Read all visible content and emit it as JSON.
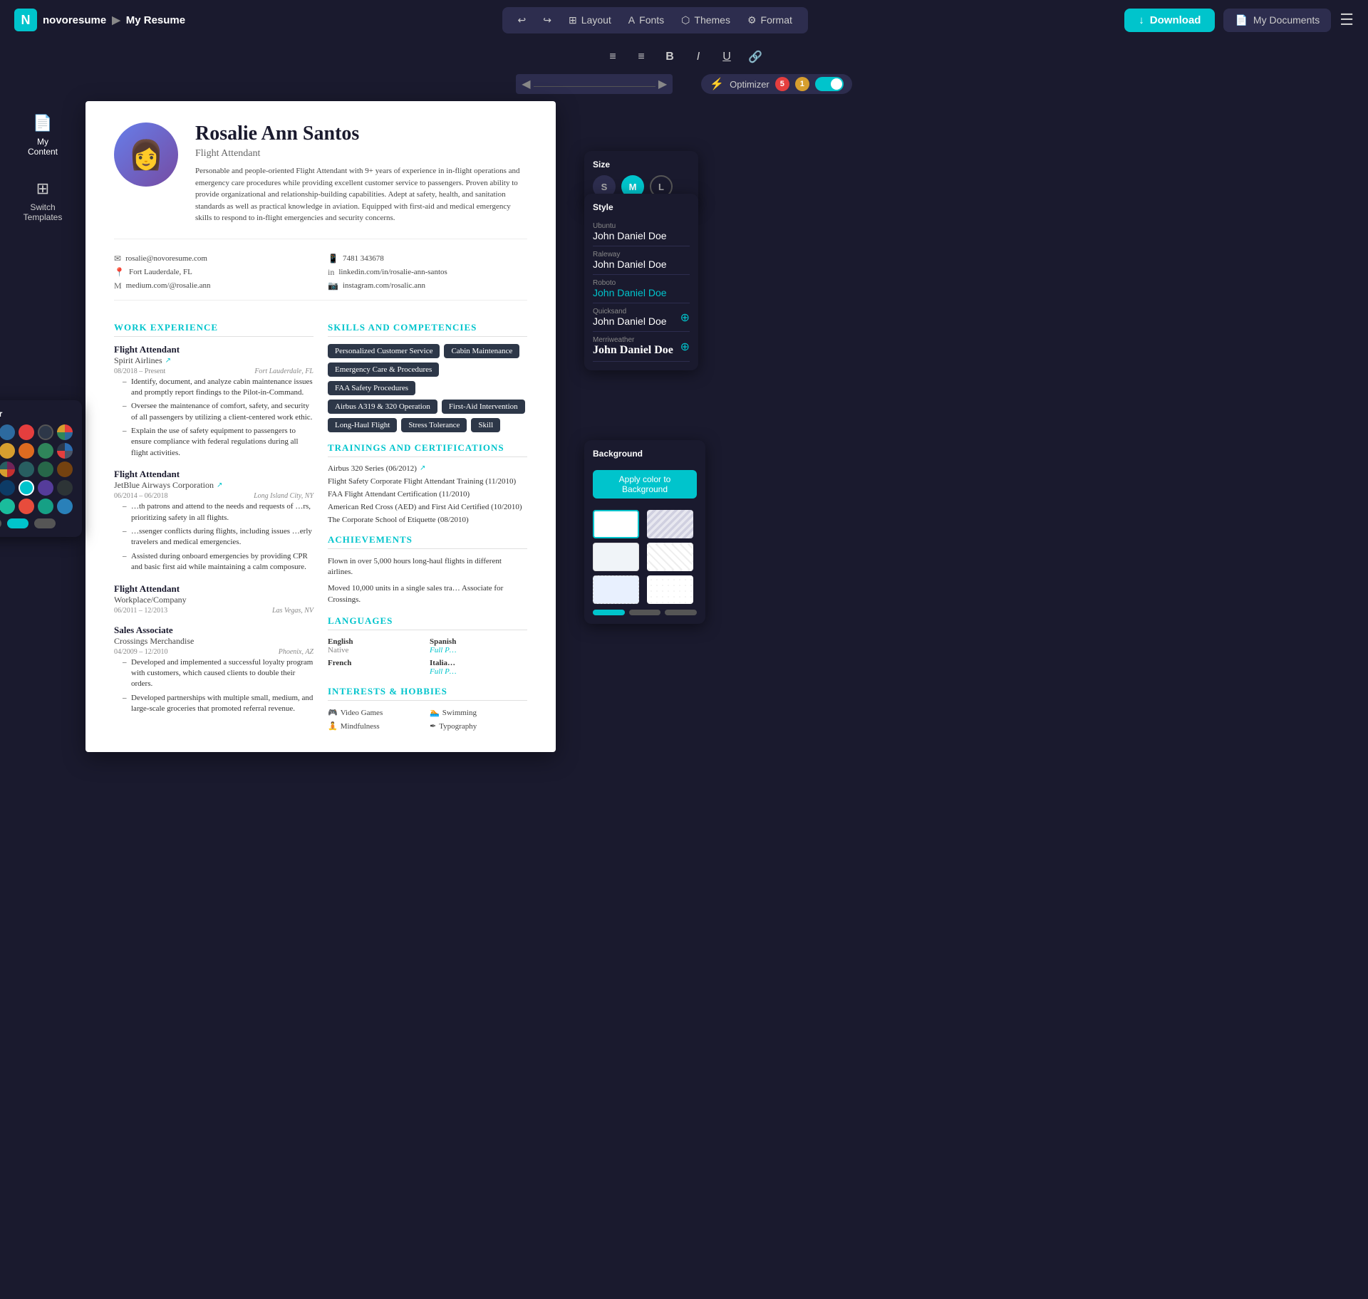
{
  "app": {
    "logo_text": "N",
    "brand_name": "novoresume",
    "breadcrumb_sep": "▶",
    "page_name": "My Resume"
  },
  "navbar": {
    "undo_icon": "↩",
    "redo_icon": "↪",
    "layout_label": "Layout",
    "fonts_label": "Fonts",
    "themes_label": "Themes",
    "format_label": "Format",
    "download_label": "Download",
    "my_docs_label": "My Documents",
    "hamburger_icon": "☰"
  },
  "format_toolbar": {
    "align_left": "≡",
    "align_center": "≡",
    "bold": "B",
    "italic": "I",
    "underline": "U",
    "link": "🔗"
  },
  "ruler": {
    "left_arrow": "◀",
    "right_arrow": "▶"
  },
  "optimizer": {
    "icon": "⚡",
    "label": "Optimizer",
    "badge_red": "5",
    "badge_yellow": "1"
  },
  "sidebar": {
    "items": [
      {
        "id": "my-content",
        "icon": "📄",
        "label": "My Content"
      },
      {
        "id": "switch-templates",
        "icon": "⊞",
        "label": "Switch Templates"
      }
    ]
  },
  "resume": {
    "name": "Rosalie Ann Santos",
    "title": "Flight Attendant",
    "summary": "Personable and people-oriented Flight Attendant with 9+ years of experience in in-flight operations and emergency care procedures while providing excellent customer service to passengers. Proven ability to provide organizational and relationship-building capabilities. Adept at safety, health, and sanitation standards as well as practical knowledge in aviation. Equipped with first-aid and medical emergency skills to respond to in-flight emergencies and security concerns.",
    "contact": {
      "email": "rosalie@novoresume.com",
      "location": "Fort Lauderdale, FL",
      "website": "medium.com/@rosalie.ann",
      "phone": "7481 343678",
      "linkedin": "linkedin.com/in/rosalie-ann-santos",
      "instagram": "instagram.com/rosalic.ann"
    },
    "sections": {
      "work_exp": "WORK EXPERIENCE",
      "skills": "SKILLS AND COMPETENCIES",
      "trainings": "TRAININGS AND CERTIFICATIONS",
      "achievements": "ACHIEVEMENTS",
      "languages": "LANGUAGES",
      "interests": "INTERESTS & HOBBIES"
    },
    "jobs": [
      {
        "title": "Flight Attendant",
        "company": "Spirit Airlines",
        "dates": "08/2018 – Present",
        "location": "Fort Lauderdale, FL",
        "bullets": [
          "Identify, document, and analyze cabin maintenance issues and promptly report findings to the Pilot-in-Command.",
          "Oversee the maintenance of comfort, safety, and security of all passengers by utilizing a client-centered work ethic.",
          "Explain the use of safety equipment to passengers to ensure compliance with federal regulations during all flight activities."
        ]
      },
      {
        "title": "Flight Attendant",
        "company": "JetBlue Airways Corporation",
        "dates": "06/2014 – 06/2018",
        "location": "Long Island City, NY",
        "bullets": [
          "…th patrons and attend to the needs and requests of …rs, prioritizing safety in all flights.",
          "…ssenger conflicts during flights, including issues …erly travelers and medical emergencies.",
          "Assisted during onboard emergencies by providing CPR and basic first aid while maintaining a calm composure."
        ]
      },
      {
        "title": "Flight Attendant",
        "company": "Workplace/Company",
        "dates": "06/2011 – 12/2013",
        "location": "Las Vegas, NV"
      },
      {
        "title": "Sales Associate",
        "company": "Crossings Merchandise",
        "dates": "04/2009 – 12/2010",
        "location": "Phoenix, AZ",
        "bullets": [
          "Developed and implemented a successful loyalty program with customers, which caused clients to double their orders.",
          "Developed partnerships with multiple small, medium, and large-scale groceries that promoted referral revenue."
        ]
      }
    ],
    "skills": [
      {
        "label": "Personalized Customer Service",
        "style": "dark"
      },
      {
        "label": "Cabin Maintenance",
        "style": "dark"
      },
      {
        "label": "Emergency Care & Procedures",
        "style": "dark"
      },
      {
        "label": "FAA Safety Procedures",
        "style": "dark"
      },
      {
        "label": "Airbus A319 & 320 Operation",
        "style": "dark"
      },
      {
        "label": "First-Aid Intervention",
        "style": "dark"
      },
      {
        "label": "Long-Haul Flight",
        "style": "dark"
      },
      {
        "label": "Stress Tolerance",
        "style": "dark"
      },
      {
        "label": "Skill",
        "style": "dark"
      }
    ],
    "certifications": [
      {
        "text": "Airbus 320 Series (06/2012)",
        "has_link": true
      },
      {
        "text": "Flight Safety Corporate Flight Attendant Training (11/2010)"
      },
      {
        "text": "FAA Flight Attendant Certification (11/2010)"
      },
      {
        "text": "American Red Cross (AED) and First Aid Certified (10/2010)"
      },
      {
        "text": "The Corporate School of Etiquette (08/2010)"
      }
    ],
    "achievements": [
      "Flown in over 5,000 hours long-haul flights in different airlines.",
      "Moved 10,000 units in a single sales tra… Associate for Crossings."
    ],
    "languages": [
      {
        "name": "English",
        "level": "Native"
      },
      {
        "name": "Spanish",
        "level": "Full P…"
      },
      {
        "name": "French",
        "level": ""
      },
      {
        "name": "Italia…",
        "level": "Full P…"
      }
    ],
    "hobbies": [
      {
        "icon": "🎮",
        "label": "Video Games"
      },
      {
        "icon": "🏊",
        "label": "Swimming"
      },
      {
        "icon": "🧘",
        "label": "Mindfulness"
      },
      {
        "icon": "✒",
        "label": "Typography"
      }
    ]
  },
  "panels": {
    "size": {
      "title": "Size",
      "options": [
        "S",
        "M",
        "L"
      ],
      "active": "M"
    },
    "font_style": {
      "title": "Style",
      "fonts": [
        {
          "label": "Ubuntu",
          "preview": "John Daniel Doe",
          "blue": false,
          "plus": false
        },
        {
          "label": "Raleway",
          "preview": "John Daniel Doe",
          "blue": false,
          "plus": false
        },
        {
          "label": "Roboto",
          "preview": "John Daniel Doe",
          "blue": true,
          "plus": false
        },
        {
          "label": "Quicksand",
          "preview": "John Daniel Doe",
          "blue": false,
          "plus": true
        },
        {
          "label": "Merriweather",
          "preview": "John Daniel Doe",
          "blue": false,
          "plus": true
        }
      ]
    },
    "color": {
      "title": "Color",
      "swatches": [
        "#1a1a2e",
        "#2d6a9f",
        "#e53e3e",
        "#2d3748",
        "#4a5568",
        "#6b46c1",
        "#d69e2e",
        "#dd6b20",
        "#2f855a",
        "#2b6cb0",
        "#702459",
        "#c53030",
        "#285e61",
        "#276749",
        "#744210",
        "#3d5a80",
        "#0d3b66",
        "#00c4cc",
        "#553c9a",
        "#2d3436",
        "#2c3e50",
        "#1abc9c",
        "#e74c3c",
        "#16a085",
        "#2980b9"
      ]
    },
    "background": {
      "title": "Background",
      "apply_label": "Apply color to Background"
    }
  }
}
